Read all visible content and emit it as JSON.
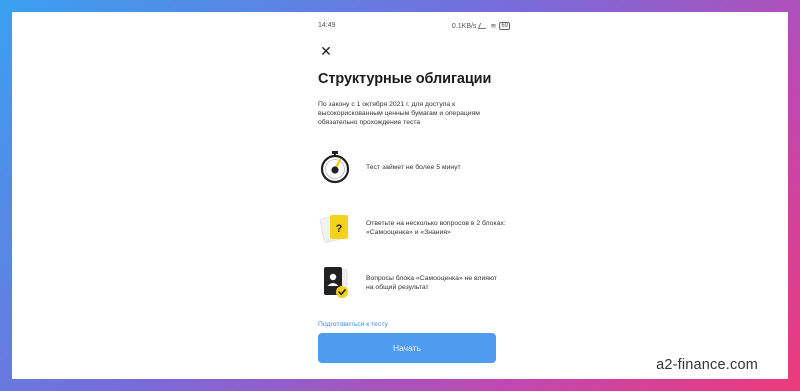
{
  "status_bar": {
    "time": "14:49",
    "network": "0.1KB/s",
    "battery": "69"
  },
  "screen": {
    "title": "Структурные облигации",
    "intro": "По закону с 1 октября 2021 г. для доступа к высокорискованным ценным бумагам и операциям обязательно прохождение теста",
    "items": [
      {
        "icon": "stopwatch-icon",
        "text": "Тест займет не более 5 минут"
      },
      {
        "icon": "question-cards-icon",
        "text": "Ответьте на несколько вопросов в 2 блоках: «Самооценка» и «Знания»"
      },
      {
        "icon": "profile-check-icon",
        "text": "Вопросы блока «Самооценка» не влияют на общий результат"
      }
    ],
    "prepare_link": "Подготовиться к тесту",
    "start_button": "Начать"
  },
  "watermark": "a2-finance.com",
  "colors": {
    "accent": "#4e9bf2",
    "link": "#3a8ef0",
    "icon_yellow": "#f7d21c"
  }
}
